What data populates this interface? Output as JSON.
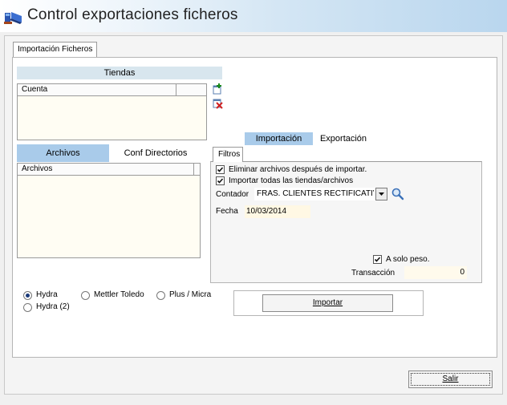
{
  "window": {
    "title": "Control exportaciones ficheros"
  },
  "main_tab": {
    "label": "Importación Ficheros"
  },
  "tiendas": {
    "header": "Tiendas",
    "column": "Cuenta",
    "add_icon": "add-icon",
    "delete_icon": "delete-icon"
  },
  "left_tabs": [
    {
      "label": "Archivos",
      "active": true
    },
    {
      "label": "Conf Directorios",
      "active": false
    }
  ],
  "archivos": {
    "column": "Archivos"
  },
  "right_tabs": [
    {
      "label": "Importación",
      "active": true
    },
    {
      "label": "Exportación",
      "active": false
    }
  ],
  "filtros": {
    "tab_label": "Filtros",
    "eliminar": {
      "label": "Eliminar archivos después de importar.",
      "checked": true
    },
    "importar_todas": {
      "label": "Importar todas las tiendas/archivos",
      "checked": true
    },
    "contador": {
      "label": "Contador",
      "value": "FRAS. CLIENTES RECTIFICATIVA",
      "search_icon": "magnifier-icon"
    },
    "fecha": {
      "label": "Fecha",
      "value": "10/03/2014"
    },
    "solo_peso": {
      "label": "A solo peso.",
      "checked": true
    },
    "transaccion": {
      "label": "Transacción",
      "value": "0"
    }
  },
  "radios": [
    {
      "label": "Hydra",
      "selected": true
    },
    {
      "label": "Mettler Toledo",
      "selected": false
    },
    {
      "label": "Plus / Micra",
      "selected": false
    },
    {
      "label": "Hydra (2)",
      "selected": false
    }
  ],
  "buttons": {
    "importar": "Importar",
    "salir": "Salir"
  },
  "colors": {
    "active_tab": "#a9cbea",
    "tiendas_bar": "#d8e6ee",
    "grid_bg": "#fffdf3"
  }
}
